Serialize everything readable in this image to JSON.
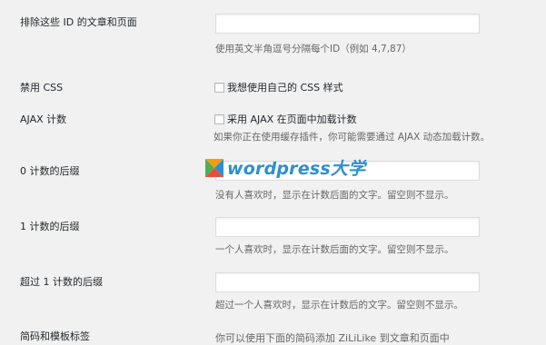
{
  "settings": {
    "exclude": {
      "label": "排除这些 ID 的文章和页面",
      "value": "",
      "desc": "使用英文半角逗号分隔每个ID（例如 4,7,87）"
    },
    "disable_css": {
      "label": "禁用 CSS",
      "checkbox_label": "我想使用自己的 CSS 样式",
      "checked": false
    },
    "ajax": {
      "label": "AJAX 计数",
      "checkbox_label": "采用 AJAX 在页面中加载计数",
      "checked": false,
      "desc": "如果你正在使用缓存插件，你可能需要通过 AJAX 动态加载计数。"
    },
    "suffix_zero": {
      "label": "0 计数的后缀",
      "value": "",
      "desc": "没有人喜欢时，显示在计数后面的文字。留空则不显示。"
    },
    "suffix_one": {
      "label": "1 计数的后缀",
      "value": "",
      "desc": "一个人喜欢时，显示在计数后面的文字。留空则不显示。"
    },
    "suffix_more": {
      "label": "超过 1 计数的后缀",
      "value": "",
      "desc": "超过一个人喜欢时，显示在计数后的文字。留空则不显示。"
    },
    "shortcode": {
      "label": "简码和模板标签",
      "desc": "你可以使用下面的简码添加 ZiLiLike 到文章和页面中"
    }
  },
  "watermark": {
    "text": "wordpress大学",
    "icon": "wordpress-daxue-logo-icon",
    "colors": {
      "text": "#2d8fd0",
      "green": "#4caf50",
      "orange": "#f39c12",
      "blue": "#2d8fd0"
    }
  }
}
